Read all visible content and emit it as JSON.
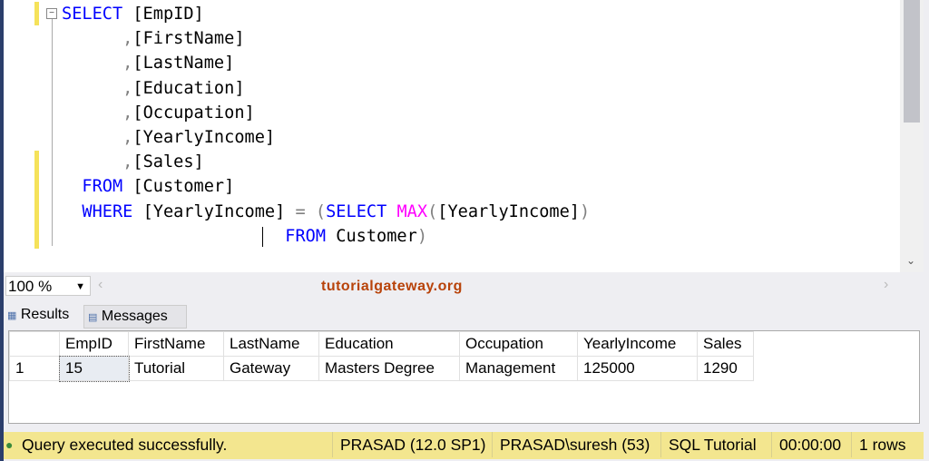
{
  "editor": {
    "lines": [
      [
        {
          "t": "SELECT",
          "c": "kw"
        },
        {
          "t": " [EmpID]",
          "c": ""
        }
      ],
      [
        {
          "t": "      ",
          "c": ""
        },
        {
          "t": ",",
          "c": "op"
        },
        {
          "t": "[FirstName]",
          "c": ""
        }
      ],
      [
        {
          "t": "      ",
          "c": ""
        },
        {
          "t": ",",
          "c": "op"
        },
        {
          "t": "[LastName]",
          "c": ""
        }
      ],
      [
        {
          "t": "      ",
          "c": ""
        },
        {
          "t": ",",
          "c": "op"
        },
        {
          "t": "[Education]",
          "c": ""
        }
      ],
      [
        {
          "t": "      ",
          "c": ""
        },
        {
          "t": ",",
          "c": "op"
        },
        {
          "t": "[Occupation]",
          "c": ""
        }
      ],
      [
        {
          "t": "      ",
          "c": ""
        },
        {
          "t": ",",
          "c": "op"
        },
        {
          "t": "[YearlyIncome]",
          "c": ""
        }
      ],
      [
        {
          "t": "      ",
          "c": ""
        },
        {
          "t": ",",
          "c": "op"
        },
        {
          "t": "[Sales]",
          "c": ""
        }
      ],
      [
        {
          "t": "  ",
          "c": ""
        },
        {
          "t": "FROM",
          "c": "kw"
        },
        {
          "t": " [Customer]",
          "c": ""
        }
      ],
      [
        {
          "t": "  ",
          "c": ""
        },
        {
          "t": "WHERE",
          "c": "kw"
        },
        {
          "t": " [YearlyIncome] ",
          "c": ""
        },
        {
          "t": "=",
          "c": "op"
        },
        {
          "t": " ",
          "c": ""
        },
        {
          "t": "(",
          "c": "op"
        },
        {
          "t": "SELECT",
          "c": "kw"
        },
        {
          "t": " ",
          "c": ""
        },
        {
          "t": "MAX",
          "c": "fn"
        },
        {
          "t": "(",
          "c": "op"
        },
        {
          "t": "[YearlyIncome]",
          "c": ""
        },
        {
          "t": ")",
          "c": "op"
        }
      ],
      [
        {
          "t": "                      ",
          "c": ""
        },
        {
          "t": "FROM",
          "c": "kw"
        },
        {
          "t": " Customer",
          "c": ""
        },
        {
          "t": ")",
          "c": "op"
        }
      ]
    ]
  },
  "zoom": {
    "value": "100 %"
  },
  "watermark": "tutorialgateway.org",
  "tabs": [
    {
      "label": "Results"
    },
    {
      "label": "Messages"
    }
  ],
  "results": {
    "columns": [
      "",
      "EmpID",
      "FirstName",
      "LastName",
      "Education",
      "Occupation",
      "YearlyIncome",
      "Sales"
    ],
    "rows": [
      [
        "1",
        "15",
        "Tutorial",
        "Gateway",
        "Masters Degree",
        "Management",
        "125000",
        "1290"
      ]
    ]
  },
  "status": {
    "message": "Query executed successfully.",
    "server": "PRASAD (12.0 SP1)",
    "user": "PRASAD\\suresh (53)",
    "database": "SQL Tutorial",
    "time": "00:00:00",
    "rows": "1 rows"
  }
}
